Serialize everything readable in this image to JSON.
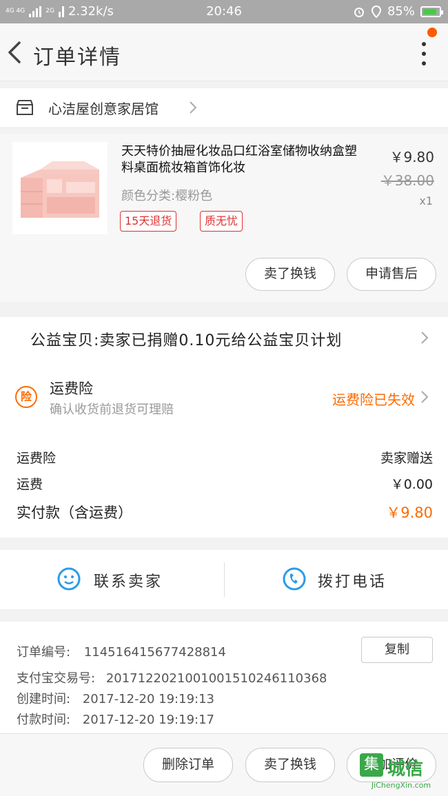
{
  "status_bar": {
    "network": "4G 4G",
    "network2": "2G",
    "speed": "2.32k/s",
    "time": "20:46",
    "battery": "85%",
    "battery_level": 0.85
  },
  "header": {
    "title": "订单详情"
  },
  "shop": {
    "name": "心洁屋创意家居馆"
  },
  "product": {
    "title": "天天特价抽屉化妆品口红浴室储物收纳盒塑料桌面梳妆箱首饰化妆",
    "price": "￥9.80",
    "original_price": "￥38.00",
    "quantity": "x1",
    "spec": "颜色分类:樱粉色",
    "tags": [
      "15天退货",
      "质无忧"
    ],
    "buttons": [
      "卖了换钱",
      "申请售后"
    ]
  },
  "charity": {
    "text": "公益宝贝:卖家已捐赠0.10元给公益宝贝计划"
  },
  "insurance": {
    "badge": "险",
    "title": "运费险",
    "subtitle": "确认收货前退货可理赔",
    "status": "运费险已失效"
  },
  "fees": [
    {
      "label": "运费险",
      "value": "卖家赠送"
    },
    {
      "label": "运费",
      "value": "￥0.00"
    },
    {
      "label": "实付款（含运费）",
      "value": "￥9.80"
    }
  ],
  "contact": {
    "seller_label": "联系卖家",
    "call_label": "拨打电话"
  },
  "order_info": {
    "order_no_label": "订单编号:",
    "order_no": "114516415677428814",
    "copy_label": "复制",
    "alipay_label": "支付宝交易号:",
    "alipay_no": "2017122021001001510246110368",
    "created_label": "创建时间:",
    "created": "2017-12-20 19:19:13",
    "paid_label": "付款时间:",
    "paid": "2017-12-20 19:19:17"
  },
  "bottom_bar": {
    "buttons": [
      "删除订单",
      "卖了换钱",
      "追加评价"
    ]
  },
  "watermark": {
    "badge": "集",
    "text": "城信",
    "url": "JiChengXin.com"
  },
  "colors": {
    "accent": "#ff6a00",
    "tag_red": "#e03030",
    "contact_blue": "#2b9be8",
    "watermark_green": "#3aa84a"
  }
}
